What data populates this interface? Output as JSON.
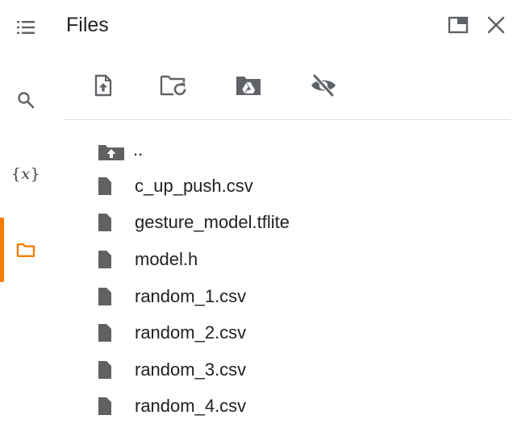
{
  "header": {
    "title": "Files"
  },
  "rail": {
    "items": [
      {
        "icon": "toc-icon"
      },
      {
        "icon": "search-icon"
      },
      {
        "icon": "variables-icon",
        "glyph_open": "{",
        "glyph_var": "x",
        "glyph_close": "}"
      },
      {
        "icon": "folder-icon",
        "active": true
      }
    ]
  },
  "toolbar": {
    "buttons": [
      {
        "icon": "upload-icon"
      },
      {
        "icon": "refresh-folder-icon"
      },
      {
        "icon": "mount-drive-icon"
      },
      {
        "icon": "hide-hidden-files-icon"
      }
    ]
  },
  "window_controls": [
    {
      "icon": "expand-icon"
    },
    {
      "icon": "close-icon"
    }
  ],
  "files": {
    "parent_label": "..",
    "items": [
      {
        "name": "c_up_push.csv"
      },
      {
        "name": "gesture_model.tflite"
      },
      {
        "name": "model.h"
      },
      {
        "name": "random_1.csv"
      },
      {
        "name": "random_2.csv"
      },
      {
        "name": "random_3.csv"
      },
      {
        "name": "random_4.csv"
      }
    ]
  },
  "colors": {
    "accent": "#f57c00",
    "icon": "#5f6368",
    "file_icon": "#616161",
    "text": "#202124",
    "divider": "#dadce0"
  }
}
